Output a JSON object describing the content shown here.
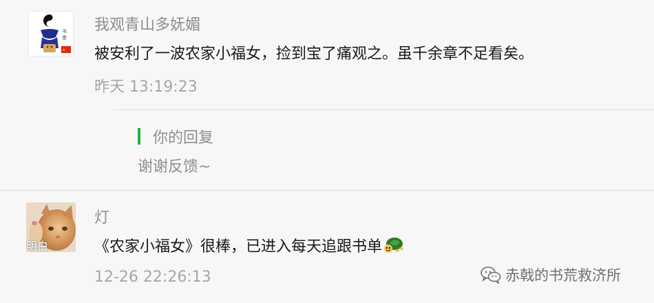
{
  "comments": [
    {
      "name": "我观青山多妩媚",
      "message": "被安利了一波农家小福女，捡到宝了痛观之。虽千余章不足看矣。",
      "time": "昨天 13:19:23",
      "reply": {
        "label": "你的回复",
        "text": "谢谢反馈~"
      },
      "avatar_icon": "taiji-figure-avatar"
    },
    {
      "name": "灯",
      "message": "《农家小福女》很棒，已进入每天追跟书单",
      "message_emoji": "turtle-emoji",
      "time": "12-26 22:26:13",
      "avatar_caption": "明白",
      "avatar_icon": "cat-avatar"
    }
  ],
  "watermark": {
    "text": "赤戟的书荒救济所",
    "icon": "wechat-logo-icon"
  },
  "colors": {
    "background": "#f7f7f7",
    "reply_accent": "#1fb33e",
    "name_text": "#8e8e8e",
    "message_text": "#1a1a1a",
    "time_text": "#a6a6a6"
  }
}
